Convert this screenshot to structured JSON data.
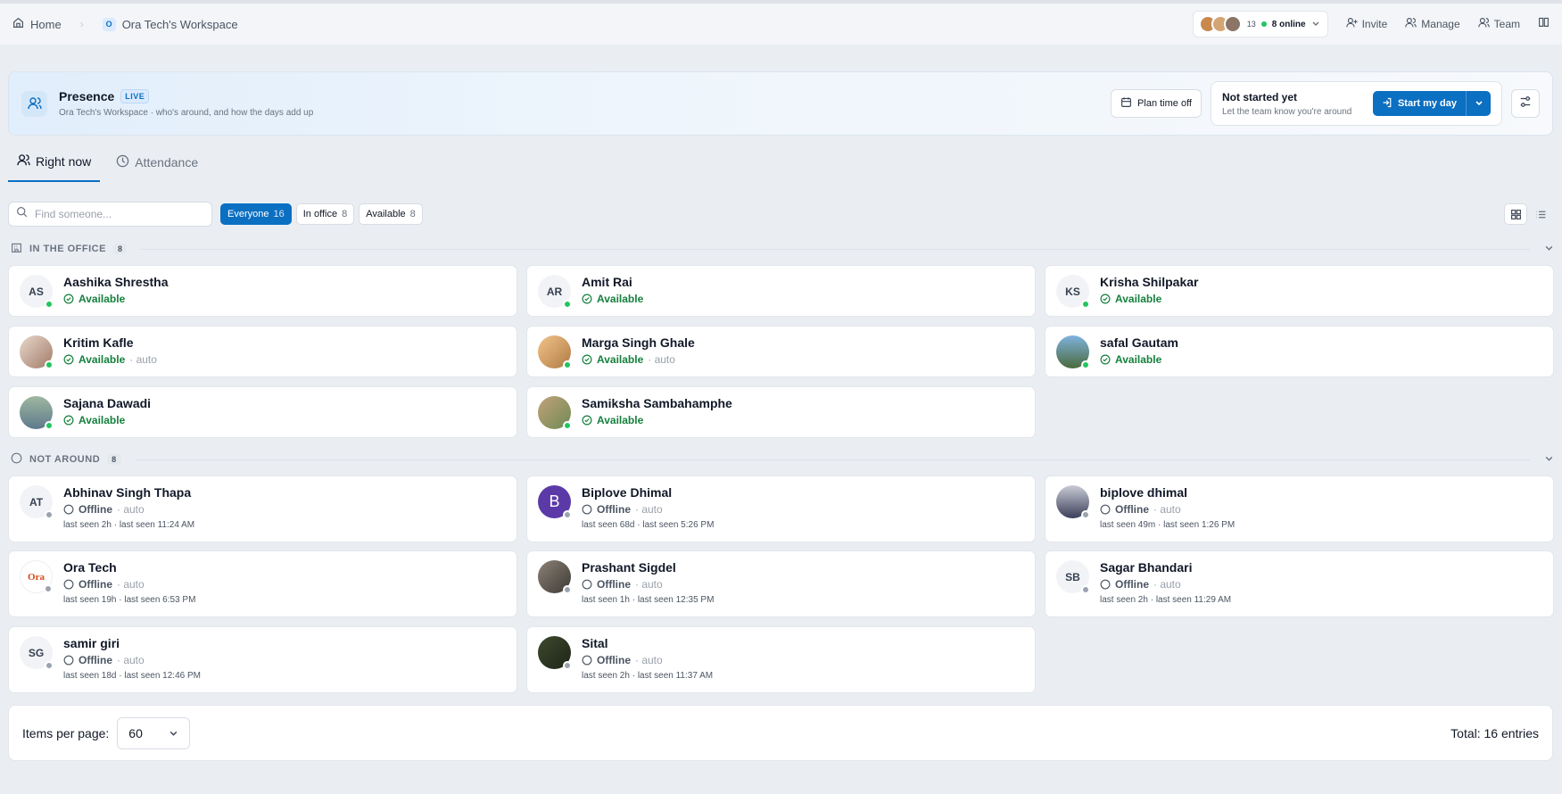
{
  "breadcrumb": {
    "home": "Home",
    "workspace_badge": "O",
    "workspace": "Ora Tech's Workspace"
  },
  "topbar": {
    "avatar_count": "13",
    "online": "8 online",
    "invite": "Invite",
    "manage": "Manage",
    "team": "Team"
  },
  "banner": {
    "title": "Presence",
    "live": "LIVE",
    "subtitle": "Ora Tech's Workspace · who's around, and how the days add up",
    "plan_time_off": "Plan time off",
    "status_title": "Not started yet",
    "status_sub": "Let the team know you're around",
    "start_label": "Start my day"
  },
  "tabs": {
    "right_now": "Right now",
    "attendance": "Attendance"
  },
  "search": {
    "placeholder": "Find someone..."
  },
  "filters": [
    {
      "label": "Everyone",
      "count": "16"
    },
    {
      "label": "In office",
      "count": "8"
    },
    {
      "label": "Available",
      "count": "8"
    }
  ],
  "sections": {
    "office": {
      "label": "IN THE OFFICE",
      "count": "8"
    },
    "away": {
      "label": "NOT AROUND",
      "count": "8"
    }
  },
  "office_people": [
    {
      "initials": "AS",
      "name": "Aashika Shrestha",
      "status": "Available",
      "auto": ""
    },
    {
      "initials": "AR",
      "name": "Amit Rai",
      "status": "Available",
      "auto": ""
    },
    {
      "initials": "KS",
      "name": "Krisha Shilpakar",
      "status": "Available",
      "auto": ""
    },
    {
      "initials": "",
      "name": "Kritim Kafle",
      "status": "Available",
      "auto": "· auto"
    },
    {
      "initials": "",
      "name": "Marga Singh Ghale",
      "status": "Available",
      "auto": "· auto"
    },
    {
      "initials": "",
      "name": "safal Gautam",
      "status": "Available",
      "auto": ""
    },
    {
      "initials": "",
      "name": "Sajana Dawadi",
      "status": "Available",
      "auto": ""
    },
    {
      "initials": "",
      "name": "Samiksha Sambahamphe",
      "status": "Available",
      "auto": ""
    }
  ],
  "away_people": [
    {
      "initials": "AT",
      "name": "Abhinav Singh Thapa",
      "status": "Offline",
      "auto": "· auto",
      "seen": "last seen 2h · last seen 11:24 AM"
    },
    {
      "initials": "B",
      "name": "Biplove Dhimal",
      "status": "Offline",
      "auto": "· auto",
      "seen": "last seen 68d · last seen 5:26 PM"
    },
    {
      "initials": "",
      "name": "biplove dhimal",
      "status": "Offline",
      "auto": "· auto",
      "seen": "last seen 49m · last seen 1:26 PM"
    },
    {
      "initials": "Ora",
      "name": "Ora Tech",
      "status": "Offline",
      "auto": "· auto",
      "seen": "last seen 19h · last seen 6:53 PM"
    },
    {
      "initials": "",
      "name": "Prashant Sigdel",
      "status": "Offline",
      "auto": "· auto",
      "seen": "last seen 1h · last seen 12:35 PM"
    },
    {
      "initials": "SB",
      "name": "Sagar Bhandari",
      "status": "Offline",
      "auto": "· auto",
      "seen": "last seen 2h · last seen 11:29 AM"
    },
    {
      "initials": "SG",
      "name": "samir giri",
      "status": "Offline",
      "auto": "· auto",
      "seen": "last seen 18d · last seen 12:46 PM"
    },
    {
      "initials": "",
      "name": "Sital",
      "status": "Offline",
      "auto": "· auto",
      "seen": "last seen 2h · last seen 11:37 AM"
    }
  ],
  "footer": {
    "per_page_label": "Items per page:",
    "per_page_value": "60",
    "total": "Total: 16 entries"
  },
  "colors": {
    "accent": "#0b6fc2",
    "available": "#15803d",
    "online_dot": "#22c55e",
    "offline_dot": "#9ca3af"
  }
}
